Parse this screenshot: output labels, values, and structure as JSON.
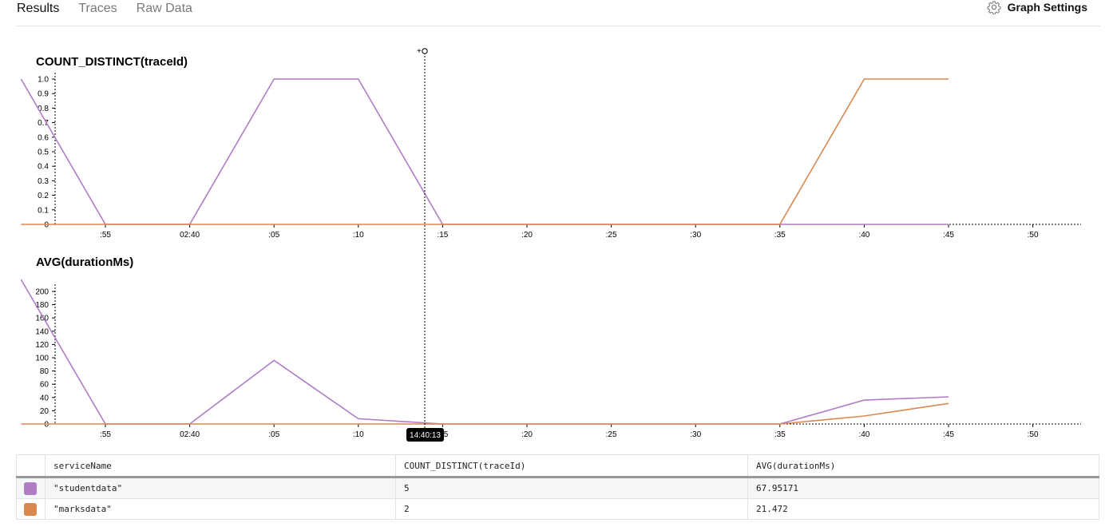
{
  "tabs": [
    {
      "label": "Results",
      "active": true
    },
    {
      "label": "Traces",
      "active": false
    },
    {
      "label": "Raw Data",
      "active": false
    }
  ],
  "graph_settings": {
    "label": "Graph Settings",
    "icon": "gear-icon"
  },
  "colors": {
    "studentdata": "#b07cc6",
    "marksdata": "#d9884e"
  },
  "cursor": {
    "time_label": "14:40:13"
  },
  "chart_data": [
    {
      "type": "line",
      "title": "COUNT_DISTINCT(traceId)",
      "x_ticks": [
        ":55",
        "02:40",
        ":05",
        ":10",
        ":15",
        ":20",
        ":25",
        ":30",
        ":35",
        ":40",
        ":45",
        ":50"
      ],
      "y_ticks": [
        "1.0",
        "0.9",
        "0.8",
        "0.7",
        "0.6",
        "0.5",
        "0.4",
        "0.3",
        "0.2",
        "0.1",
        "0"
      ],
      "ylim": [
        0,
        1.0
      ],
      "series": [
        {
          "name": "\"studentdata\"",
          "x": [
            ":50",
            ":55",
            "02:40",
            ":05",
            ":10",
            ":15",
            ":20",
            ":25",
            ":30",
            ":35",
            ":40",
            ":45"
          ],
          "values": [
            1.0,
            0,
            0,
            1.0,
            1.0,
            0,
            0,
            0,
            0,
            0,
            0,
            0
          ]
        },
        {
          "name": "\"marksdata\"",
          "x": [
            ":50",
            ":55",
            "02:40",
            ":05",
            ":10",
            ":15",
            ":20",
            ":25",
            ":30",
            ":35",
            ":40",
            ":45"
          ],
          "values": [
            0,
            0,
            0,
            0,
            0,
            0,
            0,
            0,
            0,
            0,
            1.0,
            1.0
          ]
        }
      ]
    },
    {
      "type": "line",
      "title": "AVG(durationMs)",
      "x_ticks": [
        ":55",
        "02:40",
        ":05",
        ":10",
        ":15",
        ":20",
        ":25",
        ":30",
        ":35",
        ":40",
        ":45",
        ":50"
      ],
      "y_ticks": [
        "200",
        "180",
        "160",
        "140",
        "120",
        "100",
        "80",
        "60",
        "40",
        "20",
        "0"
      ],
      "ylim": [
        0,
        220
      ],
      "series": [
        {
          "name": "\"studentdata\"",
          "x": [
            ":50",
            ":55",
            "02:40",
            ":05",
            ":10",
            ":15",
            ":20",
            ":25",
            ":30",
            ":35",
            ":40",
            ":45"
          ],
          "values": [
            218,
            0,
            0,
            96,
            8,
            0,
            0,
            0,
            0,
            0,
            36,
            41
          ]
        },
        {
          "name": "\"marksdata\"",
          "x": [
            ":50",
            ":55",
            "02:40",
            ":05",
            ":10",
            ":15",
            ":20",
            ":25",
            ":30",
            ":35",
            ":40",
            ":45"
          ],
          "values": [
            0,
            0,
            0,
            0,
            0,
            0,
            0,
            0,
            0,
            0,
            12,
            31
          ]
        }
      ]
    }
  ],
  "legend_table": {
    "columns": [
      "serviceName",
      "COUNT_DISTINCT(traceId)",
      "AVG(durationMs)"
    ],
    "rows": [
      {
        "series": "studentdata",
        "serviceName": "\"studentdata\"",
        "count": "5",
        "avg": "67.95171"
      },
      {
        "series": "marksdata",
        "serviceName": "\"marksdata\"",
        "count": "2",
        "avg": "21.472"
      }
    ]
  }
}
